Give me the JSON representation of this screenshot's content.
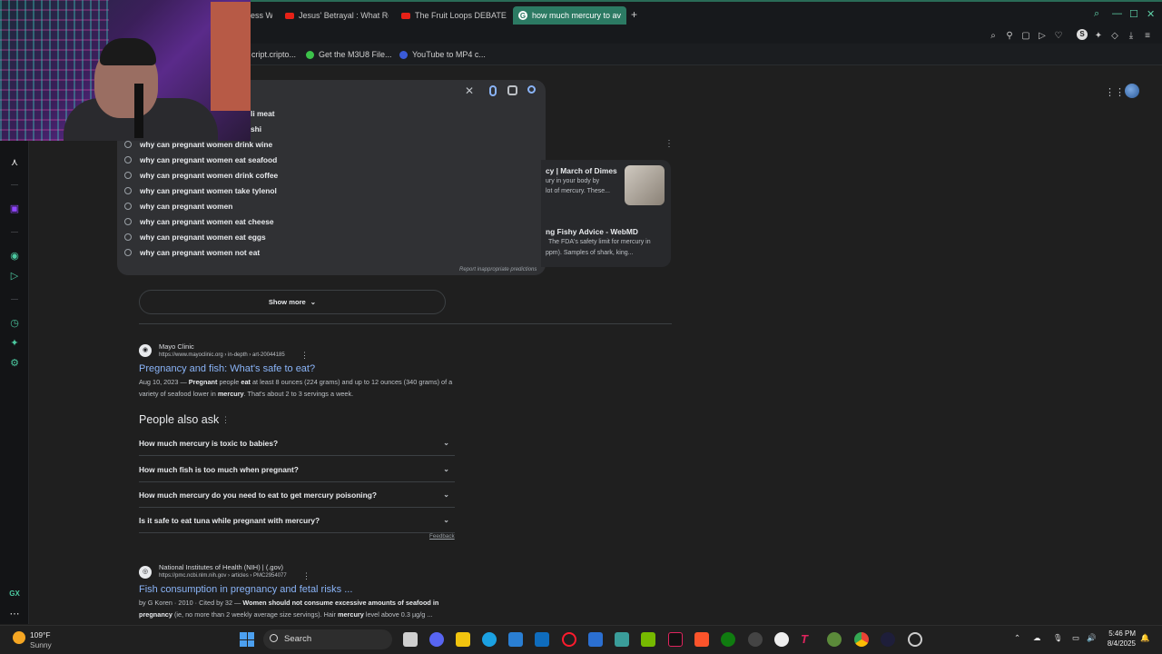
{
  "browser": {
    "tabs": [
      {
        "label": "ess W",
        "icon": "youtube-icon"
      },
      {
        "label": "Jesus' Betrayal : What Re",
        "icon": "youtube-icon"
      },
      {
        "label": "The Fruit Loops DEBATE ℓ",
        "icon": "youtube-icon"
      },
      {
        "label": "how much mercury to av",
        "icon": "google-icon",
        "active": true
      }
    ],
    "new_tab": "+",
    "bookmarks": [
      {
        "label": "cript.cripto...",
        "color": "#888888"
      },
      {
        "label": "Get the M3U8 File...",
        "color": "#3cc24a"
      },
      {
        "label": "YouTube to MP4 c...",
        "color": "#3a5bd9"
      }
    ],
    "profile_letter": "S"
  },
  "search": {
    "suggestions": [
      "li meat",
      "shi",
      "why can pregnant women drink wine",
      "why can pregnant women eat seafood",
      "why can pregnant women drink coffee",
      "why can pregnant women take tylenol",
      "why can pregnant women",
      "why can pregnant women eat cheese",
      "why can pregnant women eat eggs",
      "why can pregnant women not eat"
    ],
    "report": "Report inappropriate predictions",
    "clear_glyph": "✕"
  },
  "side_card": {
    "item1_title": "cy | March of Dimes",
    "item1_line1": "ury in your body by",
    "item1_line2": "lot of mercury. These...",
    "item2_title": "ng Fishy Advice - WebMD",
    "item2_line1": "The FDA's safety limit for mercury in",
    "item2_line2": "ppm). Samples of shark, king..."
  },
  "results": {
    "show_more": "Show more",
    "r1": {
      "site": "Mayo Clinic",
      "url": "https://www.mayoclinic.org › in-depth › art-20044185",
      "title": "Pregnancy and fish: What's safe to eat?",
      "date": "Aug 10, 2023 —",
      "s1": "Pregnant",
      "s2": "people",
      "s3": "eat",
      "s4": "at least 8 ounces (224 grams) and up to 12 ounces (340 grams) of",
      "s5": "a variety of seafood lower in",
      "s6": "mercury",
      "s7": ". That's about 2 to 3 servings a week."
    },
    "paa_title": "People also ask",
    "paa": [
      "How much mercury is toxic to babies?",
      "How much fish is too much when pregnant?",
      "How much mercury do you need to eat to get mercury poisoning?",
      "Is it safe to eat tuna while pregnant with mercury?"
    ],
    "feedback": "Feedback",
    "r2": {
      "site": "National Institutes of Health (NIH) | (.gov)",
      "url": "https://pmc.ncbi.nlm.nih.gov › articles › PMC2954077",
      "title": "Fish consumption in pregnancy and fetal risks ...",
      "meta": "by G Koren · 2010 · Cited by 32 —",
      "s1": "Women should not consume excessive amounts of seafood in",
      "s2": "pregnancy",
      "s3": "(ie, no more than 2 weekly average size servings). Hair",
      "s4": "mercury",
      "s5": "level above 0.3 µg/g ..."
    }
  },
  "taskbar": {
    "temp": "109°F",
    "condition": "Sunny",
    "search": "Search",
    "time": "5:46 PM",
    "date": "8/4/2025"
  },
  "colors": {
    "accent": "#2c7a63",
    "link": "#8ab4f8",
    "opera_icons": "#4cc9a0"
  }
}
